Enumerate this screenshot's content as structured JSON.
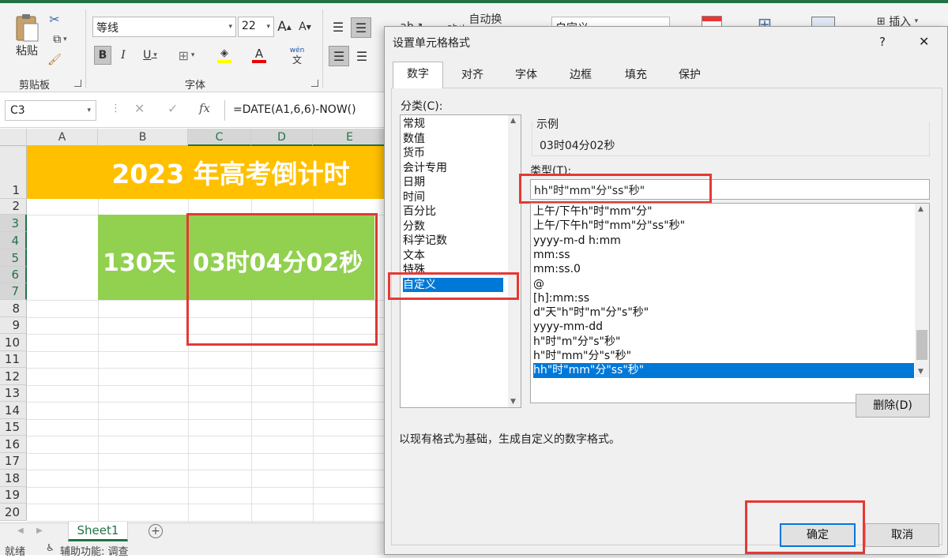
{
  "ribbon": {
    "paste_label": "粘贴",
    "clipboard_group": "剪贴板",
    "font_group": "字体",
    "font_name": "等线",
    "font_size": "22",
    "bold": "B",
    "italic": "I",
    "underline": "U",
    "grow_font": "A",
    "shrink_font": "A",
    "phonetic": "wén",
    "phonetic_char": "文",
    "wrap_text": "自动换行",
    "number_format": "自定义",
    "insert": "插入"
  },
  "formula_bar": {
    "name_box": "C3",
    "fx": "fx",
    "cancel": "✕",
    "confirm": "✓",
    "formula": "=DATE(A1,6,6)-NOW()"
  },
  "sheet": {
    "columns": [
      "A",
      "B",
      "C",
      "D",
      "E"
    ],
    "rows": [
      "1",
      "2",
      "3",
      "4",
      "5",
      "6",
      "7",
      "8",
      "9",
      "10",
      "11",
      "12",
      "13",
      "14",
      "15",
      "16",
      "17",
      "18",
      "19",
      "20"
    ],
    "banner": "2023 年高考倒计时",
    "days": "130天",
    "time": "03时04分02秒",
    "tab": "Sheet1",
    "status_ready": "就绪",
    "status_accessibility": "辅助功能: 调查"
  },
  "dialog": {
    "title": "设置单元格格式",
    "help": "?",
    "close": "✕",
    "tabs": [
      "数字",
      "对齐",
      "字体",
      "边框",
      "填充",
      "保护"
    ],
    "category_label": "分类(C):",
    "categories": [
      "常规",
      "数值",
      "货币",
      "会计专用",
      "日期",
      "时间",
      "百分比",
      "分数",
      "科学记数",
      "文本",
      "特殊",
      "自定义"
    ],
    "sample_label": "示例",
    "sample_value": "03时04分02秒",
    "type_label": "类型(T):",
    "type_value": "hh\"时\"mm\"分\"ss\"秒\"",
    "formats": [
      "上午/下午h\"时\"mm\"分\"",
      "上午/下午h\"时\"mm\"分\"ss\"秒\"",
      "yyyy-m-d h:mm",
      "mm:ss",
      "mm:ss.0",
      "@",
      "[h]:mm:ss",
      "d\"天\"h\"时\"m\"分\"s\"秒\"",
      "yyyy-mm-dd",
      "h\"时\"m\"分\"s\"秒\"",
      "h\"时\"mm\"分\"s\"秒\"",
      "hh\"时\"mm\"分\"ss\"秒\""
    ],
    "delete_button": "删除(D)",
    "description": "以现有格式为基础，生成自定义的数字格式。",
    "ok_button": "确定",
    "cancel_button": "取消"
  },
  "colors": {
    "excel_green": "#217346",
    "banner": "#ffc000",
    "green_cell": "#92d050",
    "highlight": "#e53935",
    "selection": "#0078d7"
  }
}
